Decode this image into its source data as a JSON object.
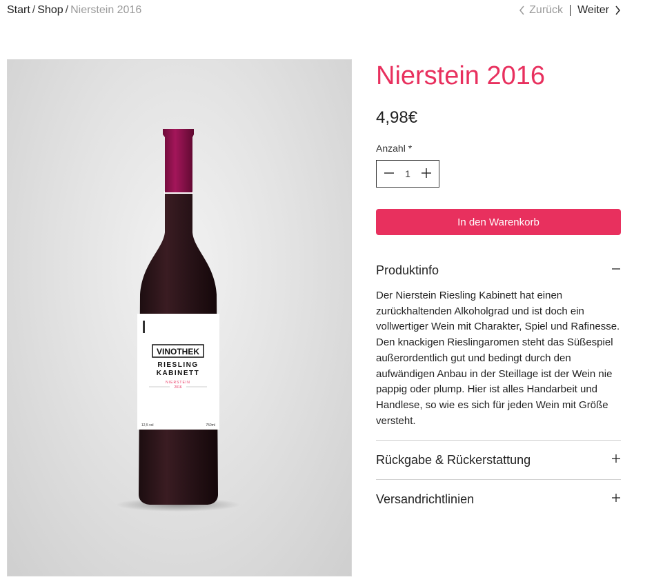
{
  "breadcrumb": {
    "items": [
      "Start",
      "Shop"
    ],
    "current": "Nierstein 2016"
  },
  "pager": {
    "prev_label": "Zurück",
    "next_label": "Weiter"
  },
  "product": {
    "title": "Nierstein 2016",
    "price": "4,98€",
    "quantity_label": "Anzahl",
    "required_mark": "*",
    "quantity": "1",
    "add_to_cart": "In den Warenkorb",
    "image": {
      "label_brand": "VINOTHEK",
      "label_line1": "RIESLING",
      "label_line2": "KABINETT",
      "label_region": "NIERSTEIN",
      "label_year": "2016",
      "label_abv": "12,5 vol",
      "label_volume": "750ml",
      "colors": {
        "capsule": "#8e1148",
        "bottle": "#2a1519",
        "accent": "#e8305e"
      }
    }
  },
  "accordion": {
    "items": [
      {
        "title": "Produktinfo",
        "expanded": true,
        "body": "Der Nierstein Riesling Kabinett hat einen zurückhaltenden Alkoholgrad und ist doch ein vollwertiger Wein mit Charakter, Spiel und Rafinesse. Den knackigen Rieslingaromen steht das Süßespiel außerordentlich gut und bedingt durch den aufwändigen Anbau in der Steillage ist der Wein nie pappig oder plump. Hier ist alles Handarbeit und Handlese, so wie es sich für jeden Wein mit Größe versteht."
      },
      {
        "title": "Rückgabe & Rückerstattung",
        "expanded": false
      },
      {
        "title": "Versandrichtlinien",
        "expanded": false
      }
    ]
  },
  "theme": {
    "accent": "#e8305e",
    "text": "#222222",
    "muted": "#9a9a9a"
  }
}
